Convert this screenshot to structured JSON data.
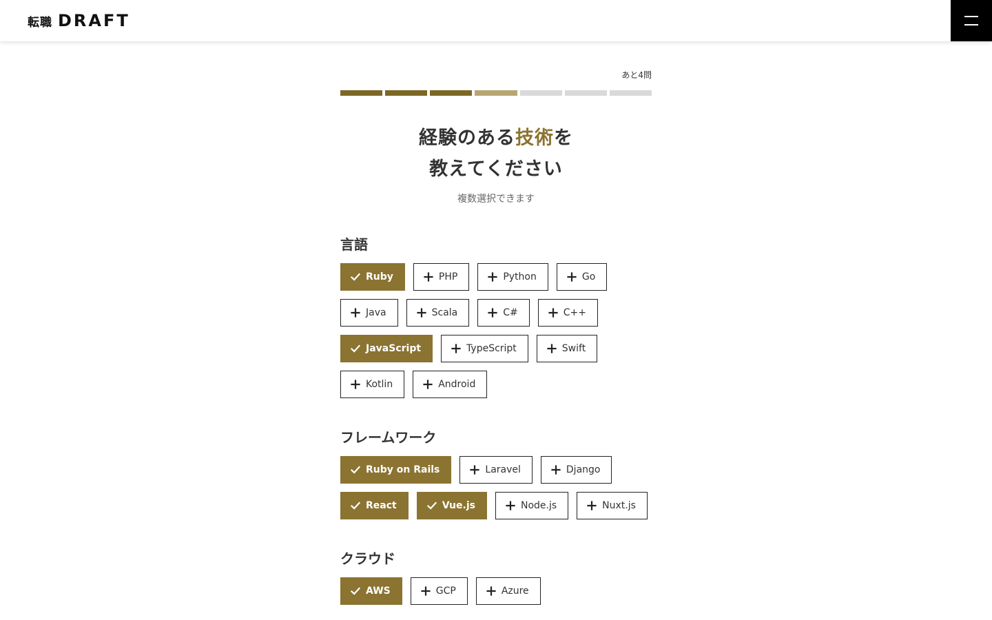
{
  "header": {
    "logo_jp": "転職",
    "logo_en": "DRAFT",
    "menu_icon": "hamburger-icon"
  },
  "progress": {
    "remaining_label": "あと4問",
    "total_steps": 7,
    "completed_steps": 3,
    "current_step": 4,
    "colors": {
      "done": "#7d6725",
      "current": "#b8a672",
      "todo": "#d9d9d9"
    }
  },
  "question": {
    "title_line1_before": "経験のある",
    "title_line1_accent": "技術",
    "title_line1_after": "を",
    "title_line2": "教えてください",
    "subtitle": "複数選択できます"
  },
  "colors": {
    "accent": "#8b7331"
  },
  "sections": [
    {
      "title": "言語",
      "rows": [
        [
          {
            "label": "Ruby",
            "selected": true
          },
          {
            "label": "PHP",
            "selected": false
          },
          {
            "label": "Python",
            "selected": false
          },
          {
            "label": "Go",
            "selected": false
          }
        ],
        [
          {
            "label": "Java",
            "selected": false
          },
          {
            "label": "Scala",
            "selected": false
          },
          {
            "label": "C#",
            "selected": false
          },
          {
            "label": "C++",
            "selected": false
          }
        ],
        [
          {
            "label": "JavaScript",
            "selected": true
          },
          {
            "label": "TypeScript",
            "selected": false
          },
          {
            "label": "Swift",
            "selected": false
          }
        ],
        [
          {
            "label": "Kotlin",
            "selected": false
          },
          {
            "label": "Android",
            "selected": false
          }
        ]
      ]
    },
    {
      "title": "フレームワーク",
      "rows": [
        [
          {
            "label": "Ruby on Rails",
            "selected": true
          },
          {
            "label": "Laravel",
            "selected": false
          },
          {
            "label": "Django",
            "selected": false
          }
        ],
        [
          {
            "label": "React",
            "selected": true
          },
          {
            "label": "Vue.js",
            "selected": true
          },
          {
            "label": "Node.js",
            "selected": false
          },
          {
            "label": "Nuxt.js",
            "selected": false
          }
        ]
      ]
    },
    {
      "title": "クラウド",
      "rows": [
        [
          {
            "label": "AWS",
            "selected": true
          },
          {
            "label": "GCP",
            "selected": false
          },
          {
            "label": "Azure",
            "selected": false
          }
        ]
      ]
    }
  ]
}
